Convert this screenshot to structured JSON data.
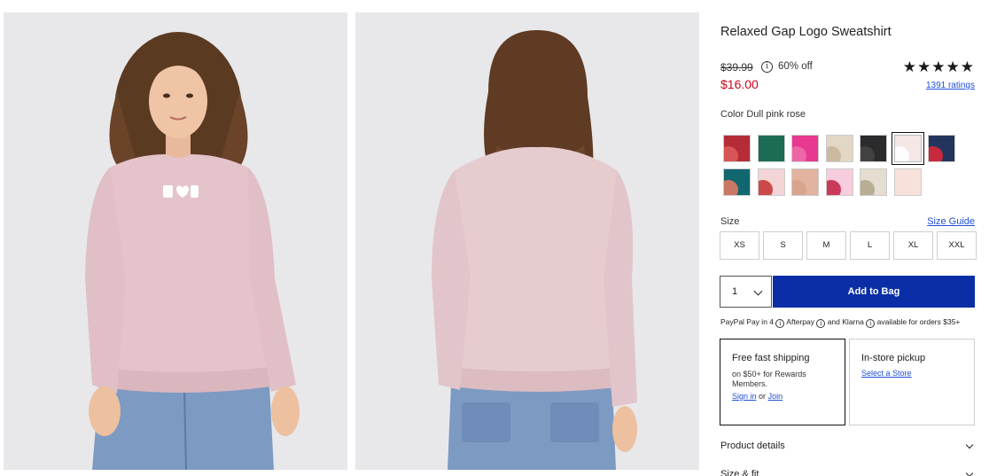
{
  "product": {
    "title": "Relaxed Gap Logo Sweatshirt",
    "original_price": "$39.99",
    "discount": "60% off",
    "sale_price": "$16.00",
    "rating_stars": "★★★★★",
    "rating_value": 5,
    "ratings_link": "1391 ratings"
  },
  "color": {
    "label": "Color Dull pink rose",
    "selected": "Dull pink rose",
    "swatches": [
      {
        "name": "red-swatch",
        "bg": "#b52c37",
        "accent": "#d95a5a"
      },
      {
        "name": "green-swatch",
        "bg": "#1c6b54",
        "accent": "#1c6b54"
      },
      {
        "name": "pink-swatch",
        "bg": "#e6398f",
        "accent": "#f06aa9"
      },
      {
        "name": "oatmeal-swatch",
        "bg": "#e2d7c5",
        "accent": "#c9b79c"
      },
      {
        "name": "black-swatch",
        "bg": "#2b2b2d",
        "accent": "#444"
      },
      {
        "name": "dull-pink-rose-swatch",
        "bg": "#f4e7e6",
        "accent": "#ffffff"
      },
      {
        "name": "navy-heart-swatch",
        "bg": "#23355c",
        "accent": "#d9283a"
      },
      {
        "name": "teal-swatch",
        "bg": "#11676f",
        "accent": "#e07a62"
      },
      {
        "name": "floral-swatch",
        "bg": "#f3d5d7",
        "accent": "#c93a3a"
      },
      {
        "name": "blush-swatch",
        "bg": "#e2b39f",
        "accent": "#d9a28a"
      },
      {
        "name": "light-pink-swatch",
        "bg": "#f7cddd",
        "accent": "#c42a4d"
      },
      {
        "name": "beige-swatch",
        "bg": "#e4ddd0",
        "accent": "#b4a78d"
      },
      {
        "name": "peach-swatch",
        "bg": "#f7e1da",
        "accent": "#f7e1da"
      }
    ]
  },
  "size": {
    "label": "Size",
    "guide_link": "Size Guide",
    "options": [
      "XS",
      "S",
      "M",
      "L",
      "XL",
      "XXL"
    ]
  },
  "cart": {
    "quantity": "1",
    "add_button": "Add to Bag"
  },
  "payment": {
    "paypal": "PayPal Pay in 4",
    "afterpay": "Afterpay",
    "and": "and",
    "klarna": "Klarna",
    "tail": "available for orders $35+"
  },
  "shipping": {
    "free_title": "Free fast shipping",
    "free_desc": "on $50+ for Rewards Members.",
    "sign_in": "Sign in",
    "or": "or",
    "join": "Join",
    "store_title": "In-store pickup",
    "store_link": "Select a Store"
  },
  "accordion": {
    "details": "Product details",
    "fit": "Size & fit"
  },
  "colors": {
    "accent_blue": "#0a2ea6",
    "sale_red": "#d0021b",
    "link_blue": "#1f4fd6"
  }
}
